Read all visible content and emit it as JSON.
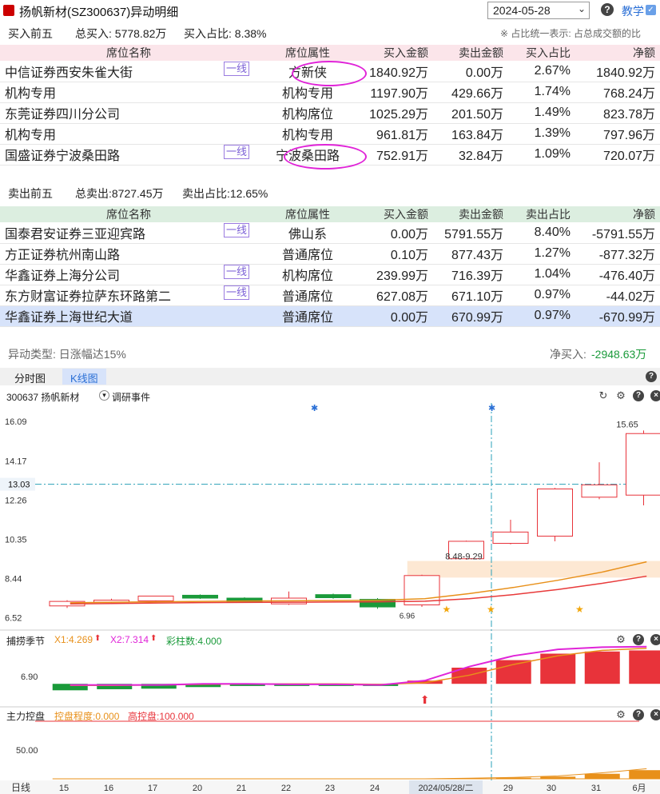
{
  "header": {
    "title": "扬帆新材(SZ300637)异动明细",
    "date": "2024-05-28",
    "help": "?",
    "teach": "教学",
    "teach_check": "✓"
  },
  "buy": {
    "title": "买入前五",
    "total": "总买入: 5778.82万",
    "ratio": "买入占比: 8.38%",
    "note": "※ 占比统一表示: 占总成交额的比",
    "columns": [
      "席位名称",
      "席位属性",
      "买入金额",
      "卖出金额",
      "买入占比",
      "净额"
    ],
    "rows": [
      {
        "name": "中信证券西安朱雀大街",
        "tag": "一线",
        "attr": "方新侠",
        "buy": "1840.92万",
        "sell": "0.00万",
        "ratio": "2.67%",
        "net": "1840.92万"
      },
      {
        "name": "机构专用",
        "tag": "",
        "attr": "机构专用",
        "buy": "1197.90万",
        "sell": "429.66万",
        "ratio": "1.74%",
        "net": "768.24万"
      },
      {
        "name": "东莞证券四川分公司",
        "tag": "",
        "attr": "机构席位",
        "buy": "1025.29万",
        "sell": "201.50万",
        "ratio": "1.49%",
        "net": "823.78万"
      },
      {
        "name": "机构专用",
        "tag": "",
        "attr": "机构专用",
        "buy": "961.81万",
        "sell": "163.84万",
        "ratio": "1.39%",
        "net": "797.96万"
      },
      {
        "name": "国盛证券宁波桑田路",
        "tag": "一线",
        "attr": "宁波桑田路",
        "buy": "752.91万",
        "sell": "32.84万",
        "ratio": "1.09%",
        "net": "720.07万"
      }
    ]
  },
  "sell": {
    "title": "卖出前五",
    "total": "总卖出:8727.45万",
    "ratio": "卖出占比:12.65%",
    "columns": [
      "席位名称",
      "席位属性",
      "买入金额",
      "卖出金额",
      "卖出占比",
      "净额"
    ],
    "rows": [
      {
        "name": "国泰君安证券三亚迎宾路",
        "tag": "一线",
        "attr": "佛山系",
        "buy": "0.00万",
        "sell": "5791.55万",
        "ratio": "8.40%",
        "net": "-5791.55万"
      },
      {
        "name": "方正证券杭州南山路",
        "tag": "",
        "attr": "普通席位",
        "buy": "0.10万",
        "sell": "877.43万",
        "ratio": "1.27%",
        "net": "-877.32万"
      },
      {
        "name": "华鑫证券上海分公司",
        "tag": "一线",
        "attr": "机构席位",
        "buy": "239.99万",
        "sell": "716.39万",
        "ratio": "1.04%",
        "net": "-476.40万"
      },
      {
        "name": "东方财富证券拉萨东环路第二",
        "tag": "一线",
        "attr": "普通席位",
        "buy": "627.08万",
        "sell": "671.10万",
        "ratio": "0.97%",
        "net": "-44.02万"
      },
      {
        "name": "华鑫证券上海世纪大道",
        "tag": "",
        "attr": "普通席位",
        "buy": "0.00万",
        "sell": "670.99万",
        "ratio": "0.97%",
        "net": "-670.99万"
      }
    ]
  },
  "summary": {
    "type_label": "异动类型: 日涨幅达15%",
    "net_label": "净买入:",
    "net_value": "-2948.63万"
  },
  "tabs": [
    "分时图",
    "K线图"
  ],
  "active_tab": 1,
  "kline": {
    "stock": "300637 扬帆新材",
    "event_toggle": "调研事件",
    "crosshair_price": "13.03",
    "annotations": {
      "low": "6.96",
      "range": "8.48-9.29",
      "high": "15.65"
    }
  },
  "indicator1": {
    "name": "捕捞季节",
    "x1": "X1:4.269",
    "x2": "X2:7.314",
    "bars": "彩柱数:4.000",
    "yticks": [
      "6.90"
    ]
  },
  "indicator2": {
    "name": "主力控盘",
    "degree": "控盘程度:0.000",
    "high": "高控盘:100.000",
    "yticks": [
      "50.00"
    ]
  },
  "xaxis": {
    "label": "日线",
    "ticks": [
      "15",
      "16",
      "17",
      "20",
      "21",
      "22",
      "23",
      "24",
      "2024/05/28/二",
      "29",
      "30",
      "31",
      "6月"
    ]
  },
  "colors": {
    "up": "#e8333a",
    "down": "#1a9a3a",
    "ma_orange": "#e8901a",
    "ma_red": "#e83a3a",
    "crosshair": "#2aa0b8",
    "accent": "#2a6fd6",
    "negative": "#1a9a3a"
  },
  "chart_data": {
    "type": "candlestick",
    "x": [
      "15",
      "16",
      "17",
      "20",
      "21",
      "22",
      "23",
      "24",
      "2024/05/28/二",
      "29",
      "30",
      "31",
      "6月"
    ],
    "yticks": [
      6.52,
      8.44,
      10.35,
      12.26,
      14.17,
      16.09
    ],
    "ylim": [
      6.0,
      16.6
    ],
    "candles": [
      {
        "o": 7.1,
        "c": 7.32,
        "h": 7.38,
        "l": 7.0
      },
      {
        "o": 7.28,
        "c": 7.38,
        "h": 7.45,
        "l": 7.25
      },
      {
        "o": 7.35,
        "c": 7.58,
        "h": 7.6,
        "l": 7.3
      },
      {
        "o": 7.62,
        "c": 7.48,
        "h": 7.66,
        "l": 7.44
      },
      {
        "o": 7.48,
        "c": 7.3,
        "h": 7.52,
        "l": 7.25
      },
      {
        "o": 7.2,
        "c": 7.48,
        "h": 7.8,
        "l": 7.15
      },
      {
        "o": 7.65,
        "c": 7.5,
        "h": 7.7,
        "l": 7.45
      },
      {
        "o": 7.42,
        "c": 7.05,
        "h": 7.48,
        "l": 6.96
      },
      {
        "o": 7.15,
        "c": 8.58,
        "h": 8.62,
        "l": 7.05
      },
      {
        "o": 9.4,
        "c": 10.25,
        "h": 10.28,
        "l": 9.35
      },
      {
        "o": 10.15,
        "c": 10.7,
        "h": 11.3,
        "l": 10.1
      },
      {
        "o": 10.5,
        "c": 12.8,
        "h": 12.85,
        "l": 10.25
      },
      {
        "o": 12.4,
        "c": 13.0,
        "h": 14.1,
        "l": 12.3
      },
      {
        "o": 12.5,
        "c": 15.5,
        "h": 15.65,
        "l": 12.0
      }
    ],
    "ma_orange": [
      7.25,
      7.28,
      7.3,
      7.32,
      7.34,
      7.35,
      7.36,
      7.38,
      7.45,
      7.7,
      8.0,
      8.35,
      8.75,
      9.25
    ],
    "ma_red": [
      7.2,
      7.22,
      7.24,
      7.26,
      7.27,
      7.28,
      7.29,
      7.3,
      7.33,
      7.45,
      7.65,
      7.9,
      8.2,
      8.55
    ],
    "band": [
      8.48,
      9.29
    ],
    "crosshair": 13.03,
    "ind1_bars": [
      -0.6,
      -0.5,
      -0.45,
      -0.3,
      -0.2,
      -0.2,
      -0.2,
      -0.2,
      0.3,
      1.5,
      2.2,
      2.8,
      3.0,
      3.1
    ],
    "ind1_x2": [
      -0.1,
      -0.1,
      -0.1,
      0.0,
      0.0,
      -0.05,
      -0.05,
      -0.1,
      0.3,
      1.6,
      2.6,
      3.2,
      3.4,
      3.45
    ],
    "ind1_x1": [
      -0.15,
      -0.15,
      -0.1,
      -0.05,
      0.0,
      0.0,
      0.0,
      -0.05,
      0.1,
      0.8,
      1.8,
      2.6,
      3.1,
      3.3
    ],
    "ind2_bars": [
      0,
      0,
      0,
      0,
      0,
      0,
      0,
      0,
      0,
      3,
      8,
      15,
      35,
      60
    ],
    "ind2_line": [
      0,
      0,
      0,
      0,
      0,
      0,
      0,
      0,
      0,
      4,
      10,
      20,
      42,
      70
    ]
  }
}
